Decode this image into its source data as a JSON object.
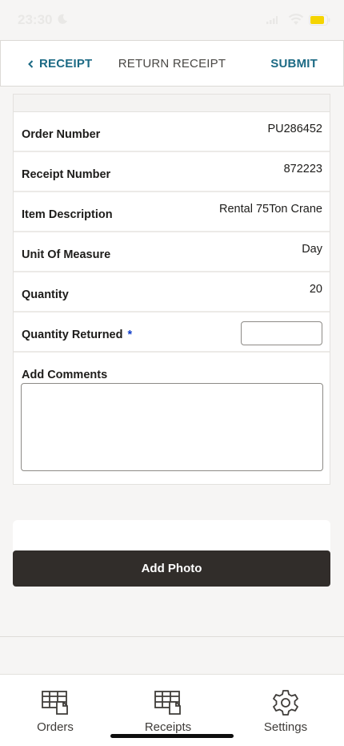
{
  "status_bar": {
    "time": "23:30",
    "accent_color": "#f5d400"
  },
  "header": {
    "back_label": "RECEIPT",
    "title": "RETURN RECEIPT",
    "submit_label": "SUBMIT"
  },
  "form": {
    "rows": [
      {
        "label": "Order Number",
        "value": "PU286452"
      },
      {
        "label": "Receipt Number",
        "value": "872223"
      },
      {
        "label": "Item Description",
        "value": "Rental 75Ton Crane"
      },
      {
        "label": "Unit Of Measure",
        "value": "Day"
      },
      {
        "label": "Quantity",
        "value": "20"
      }
    ],
    "quantity_returned": {
      "label": "Quantity Returned",
      "required_mark": "*",
      "value": ""
    },
    "comments": {
      "label": "Add Comments",
      "value": ""
    }
  },
  "add_photo_label": "Add Photo",
  "tabbar": {
    "items": [
      {
        "label": "Orders",
        "icon": "orders-icon"
      },
      {
        "label": "Receipts",
        "icon": "receipts-icon"
      },
      {
        "label": "Settings",
        "icon": "gear-icon"
      }
    ]
  }
}
